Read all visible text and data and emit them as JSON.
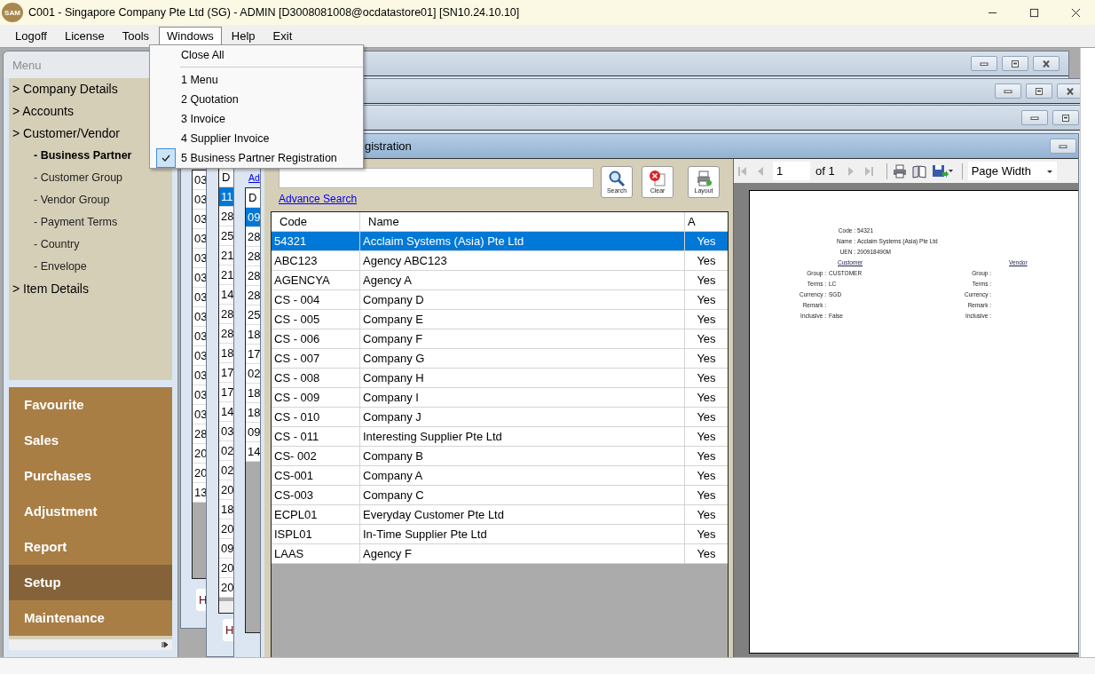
{
  "app": {
    "logo": "SAM",
    "title": "C001 - Singapore Company Pte Ltd (SG) - ADMIN [D3008081008@ocdatastore01] [SN10.24.10.10]"
  },
  "menubar": [
    {
      "label": "Logoff",
      "open": false
    },
    {
      "label": "License",
      "open": false
    },
    {
      "label": "Tools",
      "open": false
    },
    {
      "label": "Windows",
      "open": true
    },
    {
      "label": "Help",
      "open": false
    },
    {
      "label": "Exit",
      "open": false
    }
  ],
  "windows_menu": [
    {
      "kind": "command",
      "label": "Close All",
      "checked": false
    },
    {
      "kind": "separator"
    },
    {
      "kind": "window",
      "label": "1 Menu",
      "checked": false
    },
    {
      "kind": "window",
      "label": "2 Quotation",
      "checked": false
    },
    {
      "kind": "window",
      "label": "3 Invoice",
      "checked": false
    },
    {
      "kind": "window",
      "label": "4 Supplier Invoice",
      "checked": false
    },
    {
      "kind": "window",
      "label": "5 Business Partner Registration",
      "checked": true
    }
  ],
  "menu_window": {
    "title": "Menu",
    "tree": [
      {
        "label": "> Company Details",
        "selected": false
      },
      {
        "label": "> Accounts",
        "selected": false
      },
      {
        "label": "> Customer/Vendor",
        "selected": false,
        "children": [
          {
            "label": "- Business Partner",
            "selected": true
          },
          {
            "label": "- Customer Group",
            "selected": false
          },
          {
            "label": "- Vendor Group",
            "selected": false
          },
          {
            "label": "- Payment Terms",
            "selected": false
          },
          {
            "label": "- Country",
            "selected": false
          },
          {
            "label": "- Envelope",
            "selected": false
          }
        ]
      },
      {
        "label": "> Item Details",
        "selected": false
      }
    ],
    "modules": [
      {
        "label": "Favourite",
        "selected": false
      },
      {
        "label": "Sales",
        "selected": false
      },
      {
        "label": "Purchases",
        "selected": false
      },
      {
        "label": "Adjustment",
        "selected": false
      },
      {
        "label": "Report",
        "selected": false
      },
      {
        "label": "Setup",
        "selected": true
      },
      {
        "label": "Maintenance",
        "selected": false
      }
    ]
  },
  "background_windows": [
    {
      "button": "H",
      "rows": [
        {
          "value": "03",
          "selected": false
        },
        {
          "value": "03",
          "selected": false
        },
        {
          "value": "03",
          "selected": false
        },
        {
          "value": "03",
          "selected": false
        },
        {
          "value": "03",
          "selected": false
        },
        {
          "value": "03",
          "selected": false
        },
        {
          "value": "03",
          "selected": false
        },
        {
          "value": "03",
          "selected": false
        },
        {
          "value": "03",
          "selected": false
        },
        {
          "value": "03",
          "selected": false
        },
        {
          "value": "03",
          "selected": false
        },
        {
          "value": "03",
          "selected": false
        },
        {
          "value": "03",
          "selected": false
        },
        {
          "value": "28",
          "selected": false
        },
        {
          "value": "20",
          "selected": false
        },
        {
          "value": "20",
          "selected": false
        },
        {
          "value": "13",
          "selected": false
        }
      ]
    },
    {
      "button": "H",
      "column_header": "D",
      "rows": [
        {
          "value": "11",
          "selected": true
        },
        {
          "value": "28",
          "selected": false
        },
        {
          "value": "25",
          "selected": false
        },
        {
          "value": "21",
          "selected": false
        },
        {
          "value": "21",
          "selected": false
        },
        {
          "value": "14",
          "selected": false
        },
        {
          "value": "28",
          "selected": false
        },
        {
          "value": "28",
          "selected": false
        },
        {
          "value": "18",
          "selected": false
        },
        {
          "value": "17",
          "selected": false
        },
        {
          "value": "17",
          "selected": false
        },
        {
          "value": "14",
          "selected": false
        },
        {
          "value": "03",
          "selected": false
        },
        {
          "value": "02",
          "selected": false
        },
        {
          "value": "02",
          "selected": false
        },
        {
          "value": "20",
          "selected": false
        },
        {
          "value": "18",
          "selected": false
        },
        {
          "value": "20",
          "selected": false
        },
        {
          "value": "09",
          "selected": false
        },
        {
          "value": "20",
          "selected": false
        },
        {
          "value": "20",
          "selected": false
        }
      ]
    },
    {
      "column_header": "D",
      "link": "Ad",
      "rows": [
        {
          "value": "09",
          "selected": true
        },
        {
          "value": "28",
          "selected": false
        },
        {
          "value": "28",
          "selected": false
        },
        {
          "value": "28",
          "selected": false
        },
        {
          "value": "28",
          "selected": false
        },
        {
          "value": "25",
          "selected": false
        },
        {
          "value": "18",
          "selected": false
        },
        {
          "value": "17",
          "selected": false
        },
        {
          "value": "02",
          "selected": false
        },
        {
          "value": "18",
          "selected": false
        },
        {
          "value": "18",
          "selected": false
        },
        {
          "value": "09",
          "selected": false
        },
        {
          "value": "14",
          "selected": false
        }
      ]
    }
  ],
  "active_window": {
    "title": "gistration",
    "advance_search": "Advance Search",
    "tools": [
      {
        "kind": "search",
        "label": "Search"
      },
      {
        "kind": "clear",
        "label": "Clear"
      },
      {
        "kind": "layout",
        "label": "Layout"
      }
    ],
    "grid": {
      "columns": [
        "Code",
        "Name",
        "A"
      ],
      "rows": [
        {
          "cells": [
            "54321",
            "Acclaim Systems (Asia) Pte Ltd",
            "Yes"
          ],
          "selected": true
        },
        {
          "cells": [
            "ABC123",
            "Agency ABC123",
            "Yes"
          ],
          "selected": false
        },
        {
          "cells": [
            "AGENCYA",
            "Agency A",
            "Yes"
          ],
          "selected": false
        },
        {
          "cells": [
            "CS - 004",
            "Company D",
            "Yes"
          ],
          "selected": false
        },
        {
          "cells": [
            "CS - 005",
            "Company E",
            "Yes"
          ],
          "selected": false
        },
        {
          "cells": [
            "CS - 006",
            "Company F",
            "Yes"
          ],
          "selected": false
        },
        {
          "cells": [
            "CS - 007",
            "Company G",
            "Yes"
          ],
          "selected": false
        },
        {
          "cells": [
            "CS - 008",
            "Company H",
            "Yes"
          ],
          "selected": false
        },
        {
          "cells": [
            "CS - 009",
            "Company I",
            "Yes"
          ],
          "selected": false
        },
        {
          "cells": [
            "CS - 010",
            "Company J",
            "Yes"
          ],
          "selected": false
        },
        {
          "cells": [
            "CS - 011",
            "Interesting Supplier Pte Ltd",
            "Yes"
          ],
          "selected": false
        },
        {
          "cells": [
            "CS- 002",
            "Company B",
            "Yes"
          ],
          "selected": false
        },
        {
          "cells": [
            "CS-001",
            "Company A",
            "Yes"
          ],
          "selected": false
        },
        {
          "cells": [
            "CS-003",
            "Company C",
            "Yes"
          ],
          "selected": false
        },
        {
          "cells": [
            "ECPL01",
            "Everyday Customer Pte Ltd",
            "Yes"
          ],
          "selected": false
        },
        {
          "cells": [
            "ISPL01",
            "In-Time Supplier Pte Ltd",
            "Yes"
          ],
          "selected": false
        },
        {
          "cells": [
            "LAAS",
            "Agency F",
            "Yes"
          ],
          "selected": false
        }
      ]
    },
    "report": {
      "page": "1",
      "of_label": "of",
      "page_count": "1",
      "zoom": "Page Width",
      "header_fields": [
        {
          "label": "Code :",
          "value": "54321"
        },
        {
          "label": "Name :",
          "value": "Acclaim Systems (Asia) Pte Ltd"
        },
        {
          "label": "UEN :",
          "value": "200918490M"
        }
      ],
      "sections": [
        "Customer",
        "Vendor"
      ],
      "detail_rows": [
        {
          "left_label": "Group :",
          "left_value": "CUSTOMER",
          "right_label": "Group :"
        },
        {
          "left_label": "Terms :",
          "left_value": "LC",
          "right_label": "Terms :"
        },
        {
          "left_label": "Currency :",
          "left_value": "SGD",
          "right_label": "Currency :"
        },
        {
          "left_label": "Remark :",
          "right_label": "Remark :"
        },
        {
          "left_label": "Inclusive :",
          "left_value": "False",
          "right_label": "Inclusive :"
        }
      ]
    }
  }
}
